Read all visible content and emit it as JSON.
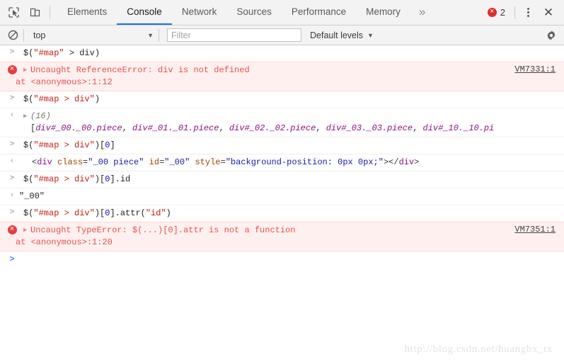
{
  "tabbar": {
    "inspect_icon": "inspect-element-icon",
    "device_icon": "device-toolbar-icon",
    "tabs": [
      {
        "label": "Elements",
        "active": false
      },
      {
        "label": "Console",
        "active": true
      },
      {
        "label": "Network",
        "active": false
      },
      {
        "label": "Sources",
        "active": false
      },
      {
        "label": "Performance",
        "active": false
      },
      {
        "label": "Memory",
        "active": false
      }
    ],
    "more_label": "»",
    "error_count": "2",
    "close_label": "✕"
  },
  "toolbar": {
    "clear_icon": "clear-console-icon",
    "context": "top",
    "context_caret": "▼",
    "filter_value": "",
    "filter_placeholder": "Filter",
    "levels_label": "Default levels",
    "levels_caret": "▼",
    "settings_icon": "gear-icon"
  },
  "console": {
    "prompt_in": ">",
    "prompt_out": "‹",
    "entries": [
      {
        "type": "command",
        "tokens": [
          {
            "t": "$(",
            "c": "plain"
          },
          {
            "t": "\"#map\"",
            "c": "str"
          },
          {
            "t": " > div)",
            "c": "plain"
          }
        ]
      },
      {
        "type": "error",
        "message": "Uncaught ReferenceError: div is not defined",
        "stack": "at <anonymous>:1:12",
        "link": "VM7331:1"
      },
      {
        "type": "command",
        "tokens": [
          {
            "t": "$(",
            "c": "plain"
          },
          {
            "t": "\"#map > div\"",
            "c": "str"
          },
          {
            "t": ")",
            "c": "plain"
          }
        ]
      },
      {
        "type": "array",
        "count": "(16)",
        "items_prefix": "[",
        "items": [
          "div#_00._00.piece",
          "div#_01._01.piece",
          "div#_02._02.piece",
          "div#_03._03.piece",
          "div#_10._10.pi"
        ]
      },
      {
        "type": "command",
        "tokens": [
          {
            "t": "$(",
            "c": "plain"
          },
          {
            "t": "\"#map > div\"",
            "c": "str"
          },
          {
            "t": ")[",
            "c": "plain"
          },
          {
            "t": "0",
            "c": "num"
          },
          {
            "t": "]",
            "c": "plain"
          }
        ]
      },
      {
        "type": "node",
        "html": "<div class=\"_00 piece\" id=\"_00\" style=\"background-position: 0px 0px;\"></div>",
        "tag": "div",
        "attrs": [
          {
            "name": "class",
            "value": "\"_00 piece\""
          },
          {
            "name": "id",
            "value": "\"_00\""
          },
          {
            "name": "style",
            "value": "\"background-position: 0px 0px;\""
          }
        ]
      },
      {
        "type": "command",
        "tokens": [
          {
            "t": "$(",
            "c": "plain"
          },
          {
            "t": "\"#map > div\"",
            "c": "str"
          },
          {
            "t": ")[",
            "c": "plain"
          },
          {
            "t": "0",
            "c": "num"
          },
          {
            "t": "].id",
            "c": "plain"
          }
        ]
      },
      {
        "type": "value",
        "value": "\"_00\""
      },
      {
        "type": "command",
        "tokens": [
          {
            "t": "$(",
            "c": "plain"
          },
          {
            "t": "\"#map > div\"",
            "c": "str"
          },
          {
            "t": ")[",
            "c": "plain"
          },
          {
            "t": "0",
            "c": "num"
          },
          {
            "t": "].attr(",
            "c": "plain"
          },
          {
            "t": "\"id\"",
            "c": "str"
          },
          {
            "t": ")",
            "c": "plain"
          }
        ]
      },
      {
        "type": "error",
        "message": "Uncaught TypeError: $(...)[0].attr is not a function",
        "stack": "at <anonymous>:1:20",
        "link": "VM7351:1"
      },
      {
        "type": "prompt"
      }
    ]
  },
  "watermark": "http://blog.csdn.net/huangbx_tx",
  "colors": {
    "accent": "#1a73e8",
    "error_red": "#e85050",
    "error_bg": "#fff0f0",
    "string": "#c41a16",
    "tagname": "#881280",
    "attrname": "#994500",
    "attrvalue": "#1a1aa6",
    "number": "#1c00cf",
    "toolbar_bg": "#f3f3f3"
  }
}
